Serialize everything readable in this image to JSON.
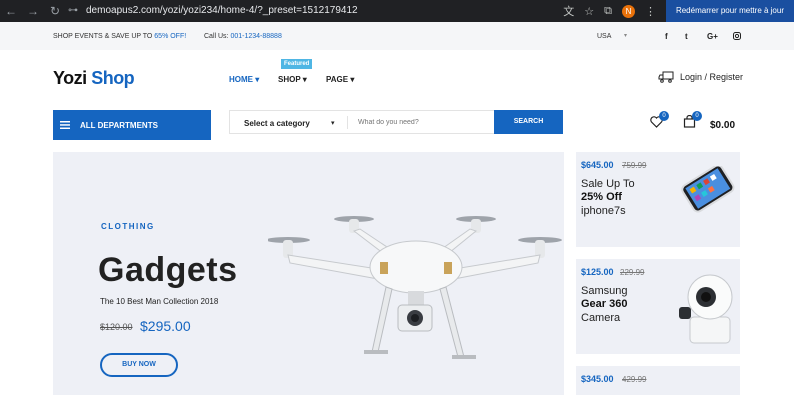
{
  "browser": {
    "url": "demoapus2.com/yozi/yozi234/home-4/?_preset=1512179412",
    "profile_initial": "N",
    "update_button": "Redémarrer pour mettre à jour"
  },
  "topbar": {
    "promo_prefix": "SHOP EVENTS & SAVE UP TO ",
    "promo_highlight": "65% OFF!",
    "call_prefix": "Call Us: ",
    "call_number": "001-1234-88888",
    "currency": "USA",
    "social_icons": [
      "facebook-icon",
      "twitter-icon",
      "google-plus-icon",
      "instagram-icon"
    ]
  },
  "header": {
    "logo_part1": "Yozi",
    "logo_part2": "Shop",
    "menu": [
      {
        "label": "HOME",
        "active": true
      },
      {
        "label": "SHOP",
        "active": false
      },
      {
        "label": "PAGE",
        "active": false
      }
    ],
    "featured_badge": "Featured",
    "login_label": "Login / Register"
  },
  "search": {
    "departments_label": "ALL DEPARTMENTS",
    "category_label": "Select a category",
    "placeholder": "What do you need?",
    "button_label": "SEARCH"
  },
  "account": {
    "wishlist_count": "0",
    "cart_count": "0",
    "cart_total": "$0.00"
  },
  "hero": {
    "subtitle": "CLOTHING",
    "title": "Gadgets",
    "tagline": "The 10 Best Man Collection 2018",
    "old_price": "$120.00",
    "new_price": "$295.00",
    "cta": "BUY NOW"
  },
  "promos": [
    {
      "price": "$645.00",
      "old_price": "759.99",
      "line1": "Sale Up To",
      "line2": "25% Off",
      "line3": "iphone7s"
    },
    {
      "price": "$125.00",
      "old_price": "229.99",
      "line1": "Samsung",
      "line2": "Gear 360",
      "line3": "Camera"
    },
    {
      "price": "$345.00",
      "old_price": "429.99"
    }
  ],
  "colors": {
    "accent": "#1565c0",
    "featured": "#4fb6e4",
    "hero_bg": "#eef0f6",
    "chrome_bg": "#202124"
  }
}
